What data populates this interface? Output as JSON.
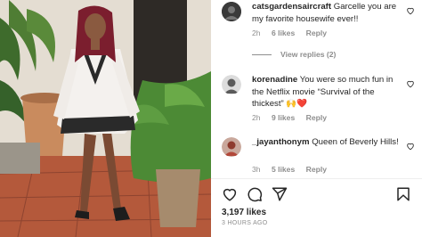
{
  "comments": [
    {
      "username": "catsgardensaircraft",
      "text": "Garcelle you are my favorite housewife ever!!",
      "time": "2h",
      "likes": "6 likes",
      "reply": "Reply",
      "avatar_icon": "user-avatar-dark"
    },
    {
      "username": "korenadine",
      "text": "You were so much fun in the Netflix movie “Survival of the thickest” 🙌❤️",
      "time": "2h",
      "likes": "9 likes",
      "reply": "Reply",
      "avatar_icon": "user-avatar-grey"
    },
    {
      "username": "_jayanthonym",
      "text": "Queen of Beverly Hills!",
      "time": "3h",
      "likes": "5 likes",
      "reply": "Reply",
      "avatar_icon": "user-avatar-red"
    }
  ],
  "view_replies": "View replies (2)",
  "actions": {
    "icons": [
      "heart-icon",
      "comment-icon",
      "share-icon",
      "bookmark-icon"
    ]
  },
  "post": {
    "likes": "3,197 likes",
    "time_ago": "3 HOURS AGO"
  },
  "colors": {
    "text": "#262626",
    "secondary": "#8e8e8e",
    "divider": "#efefef"
  }
}
